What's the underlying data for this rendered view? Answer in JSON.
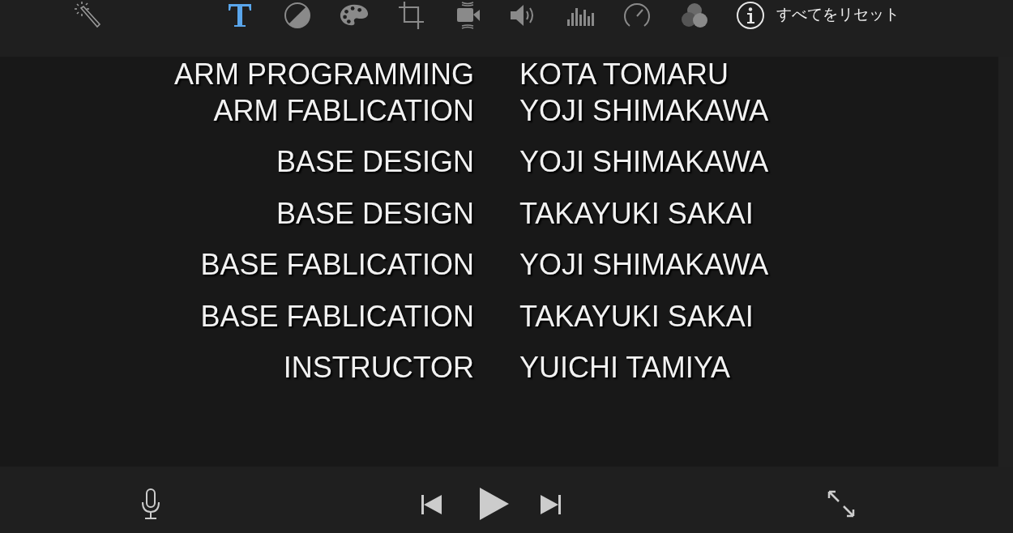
{
  "toolbar": {
    "tools": [
      {
        "kind": "enhance",
        "selected": false
      },
      {
        "kind": "title",
        "selected": true
      },
      {
        "kind": "balance",
        "selected": false
      },
      {
        "kind": "color",
        "selected": false
      },
      {
        "kind": "crop",
        "selected": false
      },
      {
        "kind": "stabilize",
        "selected": false
      },
      {
        "kind": "volume",
        "selected": false
      },
      {
        "kind": "equalizer",
        "selected": false
      },
      {
        "kind": "speed",
        "selected": false
      },
      {
        "kind": "filter",
        "selected": false
      },
      {
        "kind": "info",
        "selected": false
      }
    ],
    "reset_button": "すべてをリセット"
  },
  "credits": [
    {
      "role": "ARM PROGRAMMING",
      "name": "KOTA TOMARU"
    },
    {
      "role": "ARM FABLICATION",
      "name": "YOJI SHIMAKAWA"
    },
    {
      "role": "BASE DESIGN",
      "name": "YOJI SHIMAKAWA"
    },
    {
      "role": "BASE DESIGN",
      "name": "TAKAYUKI SAKAI"
    },
    {
      "role": "BASE FABLICATION",
      "name": "YOJI SHIMAKAWA"
    },
    {
      "role": "BASE FABLICATION",
      "name": "TAKAYUKI SAKAI"
    },
    {
      "role": "INSTRUCTOR",
      "name": "YUICHI TAMIYA"
    }
  ]
}
